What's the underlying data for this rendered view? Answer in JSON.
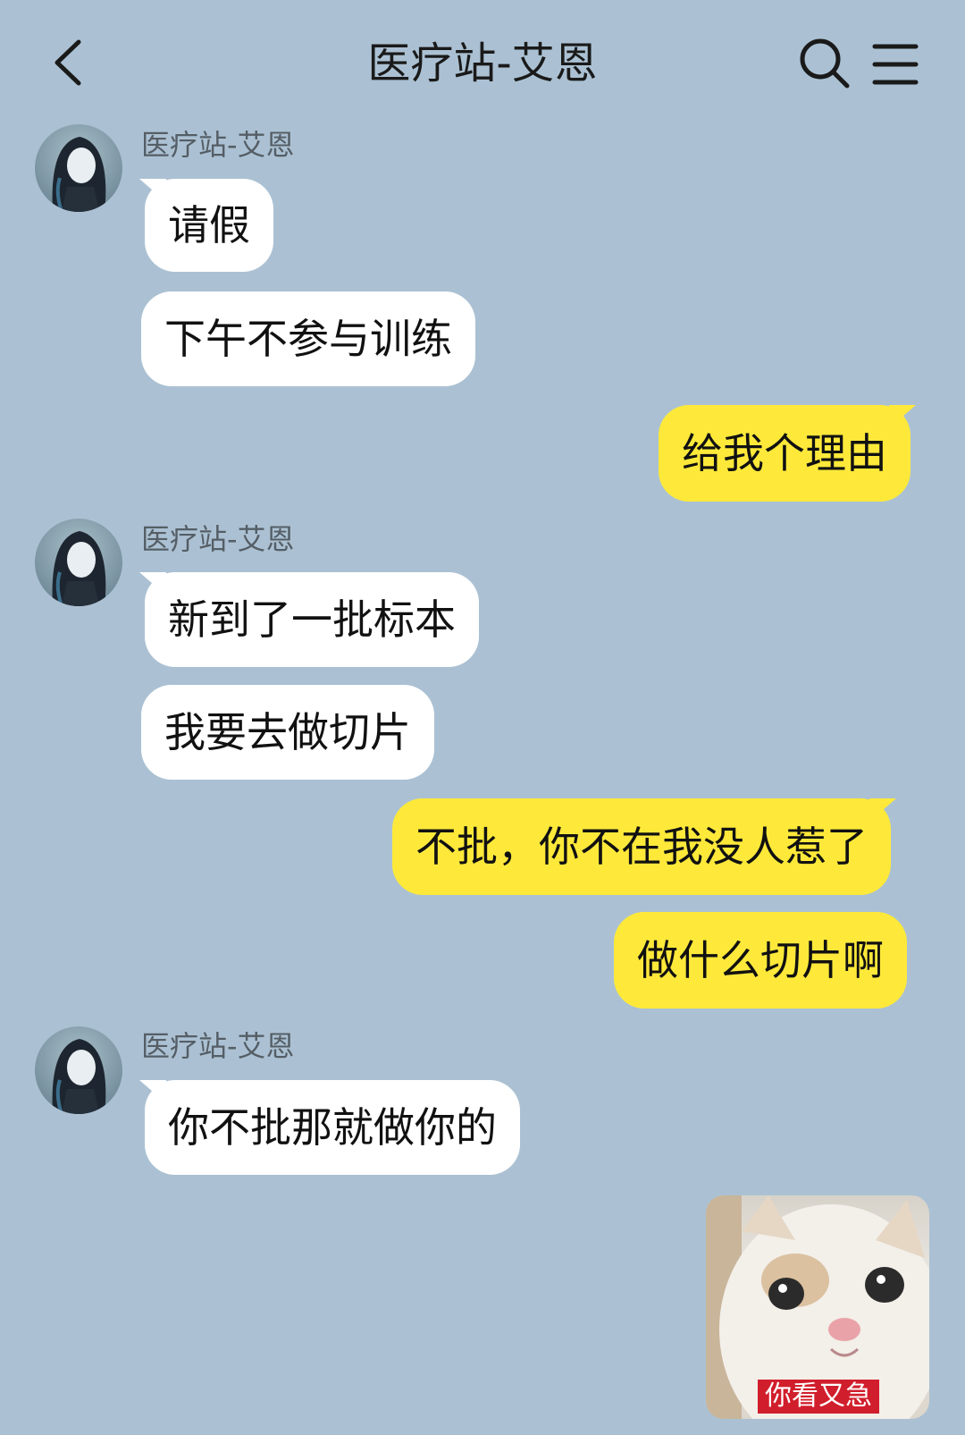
{
  "header": {
    "title": "医疗站-艾恩",
    "back_icon": "chevron-left-icon",
    "search_icon": "search-icon",
    "menu_icon": "menu-icon"
  },
  "colors": {
    "background": "#abc1d3",
    "incoming_bubble": "#ffffff",
    "outgoing_bubble": "#fee93a",
    "sticker_caption_bg": "#d11e2c"
  },
  "messages": [
    {
      "sender": "医疗站-艾恩",
      "direction": "in",
      "lines": [
        "请假",
        "下午不参与训练"
      ]
    },
    {
      "direction": "out",
      "lines": [
        "给我个理由"
      ]
    },
    {
      "sender": "医疗站-艾恩",
      "direction": "in",
      "lines": [
        "新到了一批标本",
        "我要去做切片"
      ]
    },
    {
      "direction": "out",
      "lines": [
        "不批，你不在我没人惹了",
        "做什么切片啊"
      ]
    },
    {
      "sender": "医疗站-艾恩",
      "direction": "in",
      "lines": [
        "你不批那就做你的"
      ]
    }
  ],
  "sticker": {
    "caption": "你看又急"
  }
}
